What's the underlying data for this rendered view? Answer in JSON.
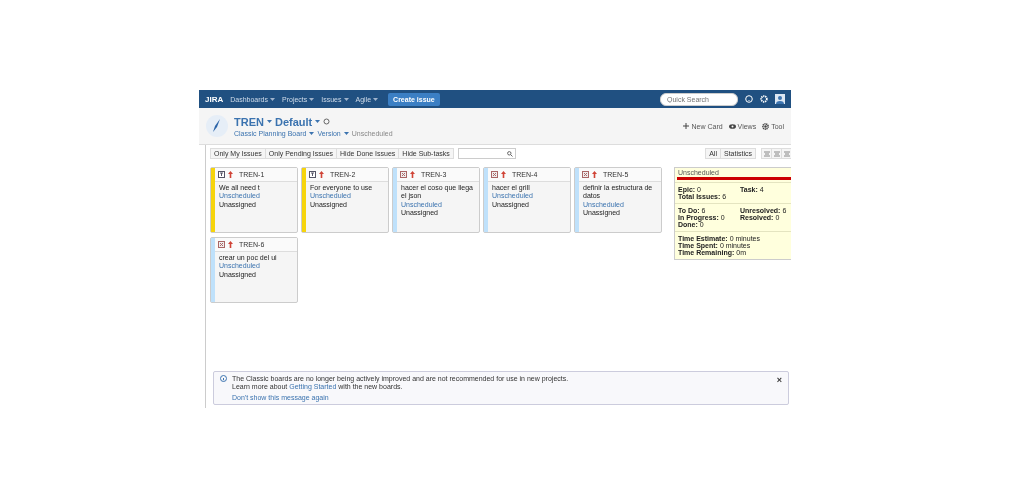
{
  "nav": {
    "logo": "JIRA",
    "menus": [
      {
        "label": "Dashboards"
      },
      {
        "label": "Projects"
      },
      {
        "label": "Issues"
      },
      {
        "label": "Agile"
      }
    ],
    "create": "Create issue",
    "search": {
      "placeholder": "Quick Search"
    }
  },
  "project": {
    "key": "TREN",
    "board": "Default",
    "links": [
      "Classic Planning Board",
      "Version"
    ],
    "scope": "Unscheduled",
    "actions": [
      {
        "kind": "add",
        "label": "New Card"
      },
      {
        "kind": "views",
        "label": "Views"
      },
      {
        "kind": "tools",
        "label": "Tool"
      }
    ]
  },
  "filters": [
    {
      "label": "Only My Issues"
    },
    {
      "label": "Only Pending Issues"
    },
    {
      "label": "Hide Done Issues"
    },
    {
      "label": "Hide Sub-tasks"
    }
  ],
  "view_buttons": [
    {
      "label": "All"
    },
    {
      "label": "Statistics"
    }
  ],
  "cards": [
    {
      "key": "TREN-1",
      "kind": "story",
      "color": "#f6d40c",
      "summary": "We all need t",
      "status": "Unscheduled",
      "assignee": "Unassigned"
    },
    {
      "key": "TREN-2",
      "kind": "story",
      "color": "#f6d40c",
      "summary": "For everyone to use",
      "status": "Unscheduled",
      "assignee": "Unassigned"
    },
    {
      "key": "TREN-3",
      "kind": "task",
      "color": "#bfe1fb",
      "summary": "hacer el coso que llega el json",
      "status": "Unscheduled",
      "assignee": "Unassigned"
    },
    {
      "key": "TREN-4",
      "kind": "task",
      "color": "#bfe1fb",
      "summary": "hacer el grill",
      "status": "Unscheduled",
      "assignee": "Unassigned"
    },
    {
      "key": "TREN-5",
      "kind": "task",
      "color": "#bfe1fb",
      "summary": "definir la estructura de datos",
      "status": "Unscheduled",
      "assignee": "Unassigned"
    },
    {
      "key": "TREN-6",
      "kind": "task",
      "color": "#bfe1fb",
      "summary": "crear un poc del ui",
      "status": "Unscheduled",
      "assignee": "Unassigned"
    }
  ],
  "stats": {
    "title": "Unscheduled",
    "level": 1,
    "groups": [
      [
        {
          "label": "Epic:",
          "value": "0"
        },
        {
          "label": "Task:",
          "value": "4"
        },
        {
          "label": "Total Issues:",
          "value": "6"
        }
      ],
      [
        {
          "label": "To Do:",
          "value": "6"
        },
        {
          "label": "Unresolved:",
          "value": "6"
        },
        {
          "label": "In Progress:",
          "value": "0"
        },
        {
          "label": "Resolved:",
          "value": "0"
        },
        {
          "label": "Done:",
          "value": "0"
        }
      ],
      [
        {
          "label": "Time Estimate:",
          "value": "0 minutes"
        },
        {
          "label": "Time Spent:",
          "value": "0 minutes"
        },
        {
          "label": "Time Remaining:",
          "value": "0m"
        }
      ]
    ]
  },
  "notice": {
    "line1": "The Classic boards are no longer being actively improved and are not recommended for use in new projects.",
    "line2_before": "Learn more about",
    "link": "Getting Started",
    "line2_after": "with the new boards.",
    "dismiss": "Don't show this message again",
    "close": "×"
  }
}
